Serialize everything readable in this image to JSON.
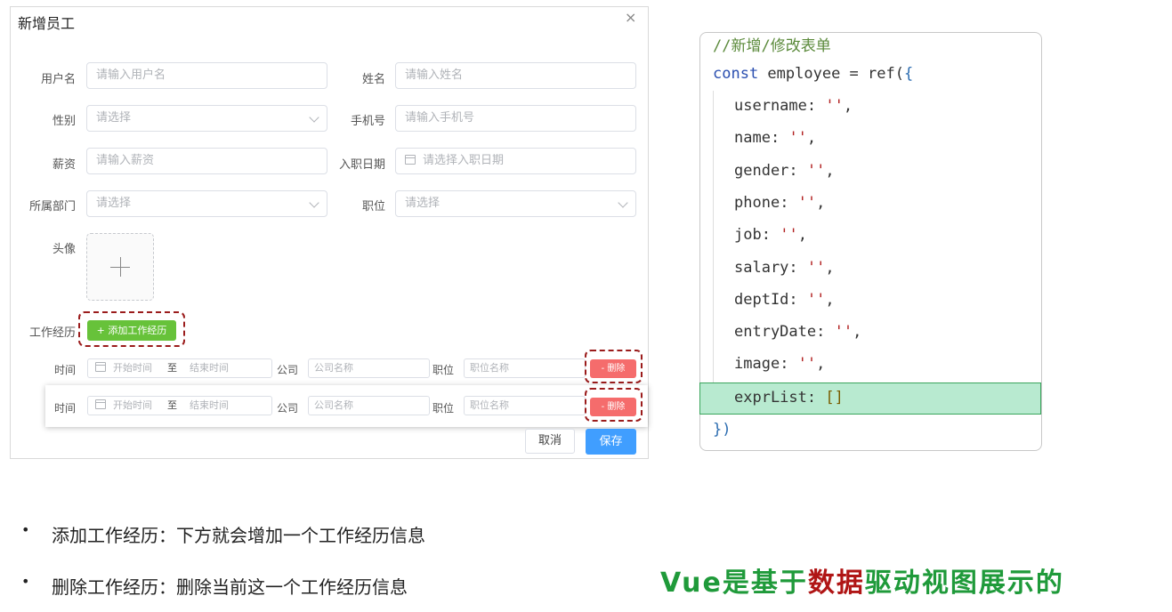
{
  "dialog": {
    "title": "新增员工",
    "close": "×",
    "fields": {
      "username": {
        "label": "用户名",
        "placeholder": "请输入用户名"
      },
      "name": {
        "label": "姓名",
        "placeholder": "请输入姓名"
      },
      "gender": {
        "label": "性别",
        "placeholder": "请选择"
      },
      "phone": {
        "label": "手机号",
        "placeholder": "请输入手机号"
      },
      "salary": {
        "label": "薪资",
        "placeholder": "请输入薪资"
      },
      "entry_date": {
        "label": "入职日期",
        "placeholder": "请选择入职日期"
      },
      "dept": {
        "label": "所属部门",
        "placeholder": "请选择"
      },
      "job": {
        "label": "职位",
        "placeholder": "请选择"
      },
      "avatar": {
        "label": "头像"
      }
    },
    "experience": {
      "label": "工作经历",
      "add_button": "+ 添加工作经历",
      "rows": [
        {
          "time_label": "时间",
          "start": "开始时间",
          "to": "至",
          "end": "结束时间",
          "company_label": "公司",
          "company_placeholder": "公司名称",
          "job_label": "职位",
          "job_placeholder": "职位名称",
          "delete": "- 删除"
        },
        {
          "time_label": "时间",
          "start": "开始时间",
          "to": "至",
          "end": "结束时间",
          "company_label": "公司",
          "company_placeholder": "公司名称",
          "job_label": "职位",
          "job_placeholder": "职位名称",
          "delete": "- 删除"
        }
      ]
    },
    "cancel": "取消",
    "save": "保存"
  },
  "code": {
    "comment": "//新增/修改表单",
    "decl_kw": "const",
    "decl_rest": " employee = ref(",
    "open": "{",
    "props": [
      {
        "key": "username",
        "val": "''",
        "comma": ","
      },
      {
        "key": "name",
        "val": "''",
        "comma": ","
      },
      {
        "key": "gender",
        "val": "''",
        "comma": ","
      },
      {
        "key": "phone",
        "val": "''",
        "comma": ","
      },
      {
        "key": "job",
        "val": "''",
        "comma": ","
      },
      {
        "key": "salary",
        "val": "''",
        "comma": ","
      },
      {
        "key": "deptId",
        "val": "''",
        "comma": ","
      },
      {
        "key": "entryDate",
        "val": "''",
        "comma": ","
      },
      {
        "key": "image",
        "val": "''",
        "comma": ","
      }
    ],
    "highlight": {
      "key": "exprList",
      "val": "[]"
    },
    "close": "})"
  },
  "bullets": [
    "添加工作经历：下方就会增加一个工作经历信息",
    "删除工作经历：删除当前这一个工作经历信息"
  ],
  "bullet_dot": "•",
  "slogan": {
    "a": "Vue是基于",
    "hot": "数据",
    "b": "驱动视图展示的"
  },
  "colors": {
    "add": "#67c23a",
    "delete": "#f56c6c",
    "save": "#409eff",
    "highlight": "#b8ead0",
    "dash": "#9b1c1c"
  }
}
